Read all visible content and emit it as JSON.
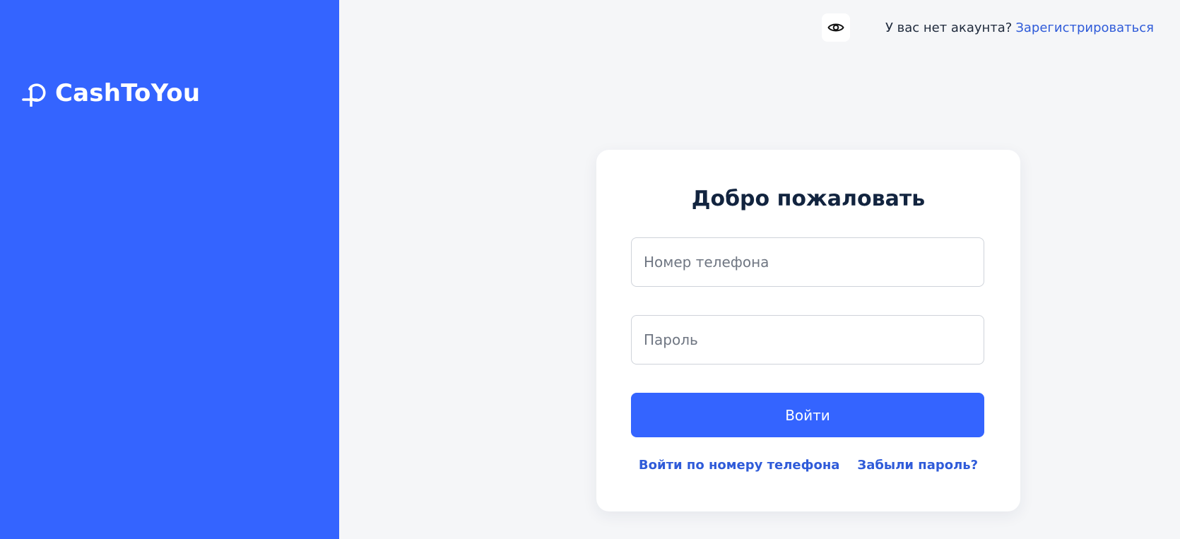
{
  "brand": {
    "name": "CashToYou",
    "icon": "ruble-coin-icon",
    "panel_color": "#3464ff"
  },
  "header": {
    "theme_toggle_icon": "eye-icon",
    "no_account_text": "У вас нет акаунта?",
    "signup_link": "Зарегистрироваться"
  },
  "login_form": {
    "title": "Добро пожаловать",
    "phone_placeholder": "Номер телефона",
    "phone_value": "",
    "password_placeholder": "Пароль",
    "password_value": "",
    "submit_label": "Войти",
    "phone_login_link": "Войти по номеру телефона",
    "forgot_password_link": "Забыли пароль?"
  },
  "colors": {
    "accent": "#3464ff",
    "link": "#2f5bd9",
    "heading": "#12243f",
    "background": "#f5f6f8"
  }
}
